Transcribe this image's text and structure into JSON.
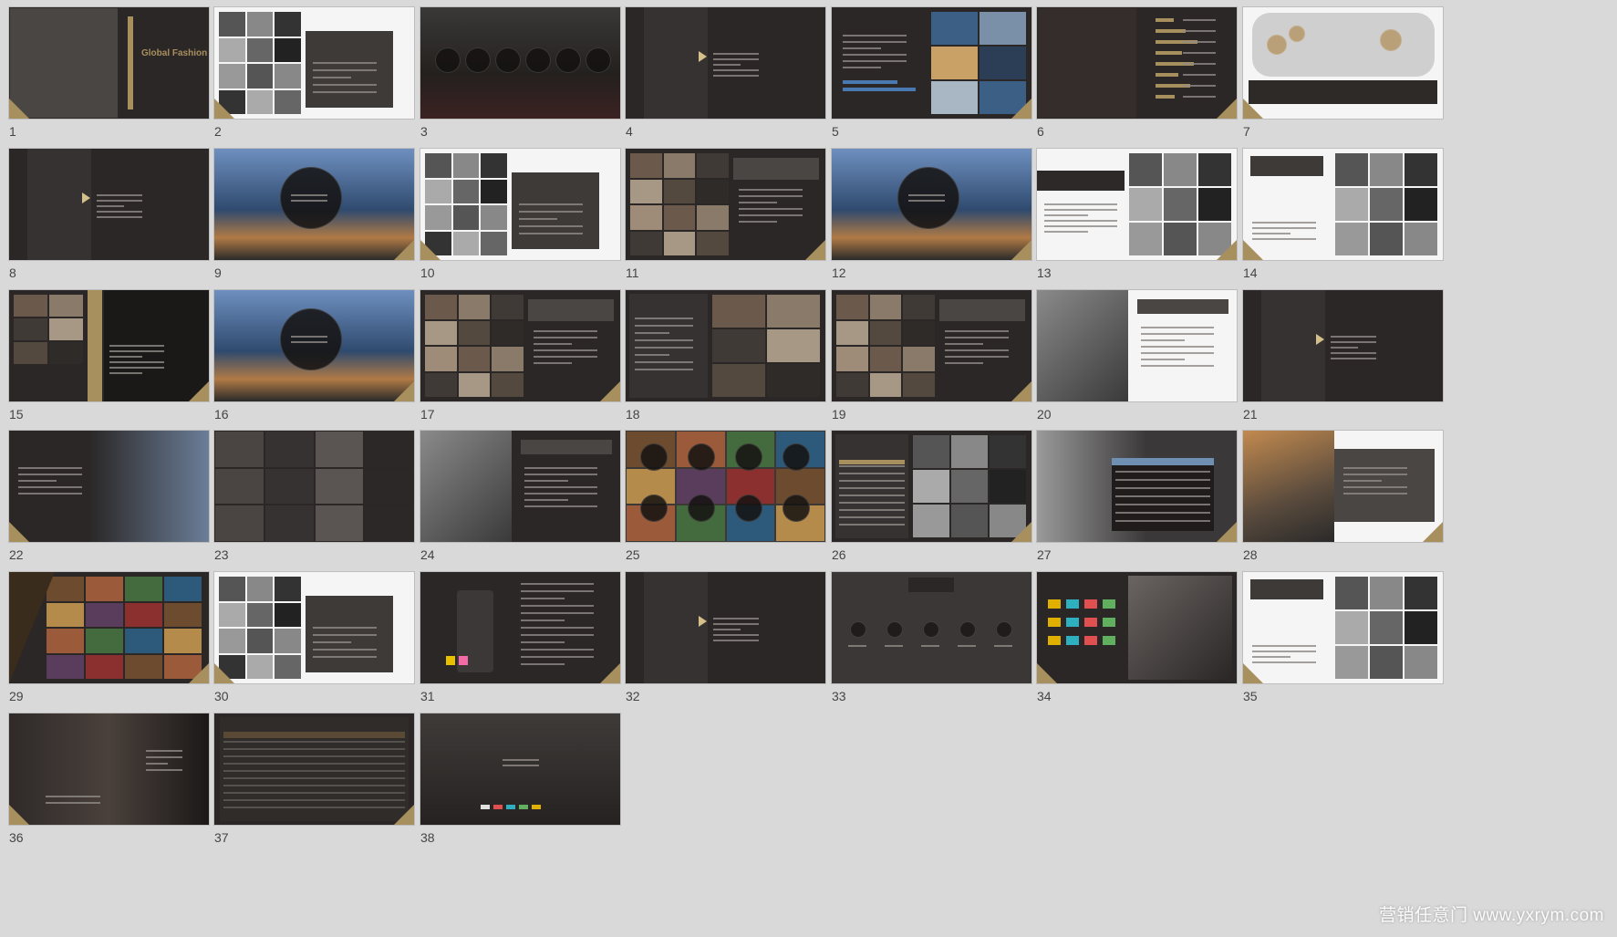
{
  "slides": [
    {
      "n": "1",
      "style": "dark",
      "variant": "cover",
      "caption": "Global Fashion Trip"
    },
    {
      "n": "2",
      "style": "light",
      "variant": "collage-left"
    },
    {
      "n": "3",
      "style": "photo",
      "variant": "circles"
    },
    {
      "n": "4",
      "style": "dark",
      "variant": "video"
    },
    {
      "n": "5",
      "style": "dark",
      "variant": "chart-photos"
    },
    {
      "n": "6",
      "style": "dark",
      "variant": "bars"
    },
    {
      "n": "7",
      "style": "light",
      "variant": "map"
    },
    {
      "n": "8",
      "style": "dark",
      "variant": "video"
    },
    {
      "n": "9",
      "style": "photo",
      "variant": "city-circle"
    },
    {
      "n": "10",
      "style": "light",
      "variant": "collage-left"
    },
    {
      "n": "11",
      "style": "dark",
      "variant": "grid-left"
    },
    {
      "n": "12",
      "style": "photo",
      "variant": "city-circle"
    },
    {
      "n": "13",
      "style": "light",
      "variant": "text-right-grid"
    },
    {
      "n": "14",
      "style": "light",
      "variant": "collage-right"
    },
    {
      "n": "15",
      "style": "dark",
      "variant": "split-gold"
    },
    {
      "n": "16",
      "style": "photo",
      "variant": "city-circle"
    },
    {
      "n": "17",
      "style": "dark",
      "variant": "grid-left"
    },
    {
      "n": "18",
      "style": "dark",
      "variant": "text-left-grid"
    },
    {
      "n": "19",
      "style": "dark",
      "variant": "grid-left"
    },
    {
      "n": "20",
      "style": "light",
      "variant": "photo-left-text"
    },
    {
      "n": "21",
      "style": "dark",
      "variant": "video"
    },
    {
      "n": "22",
      "style": "light",
      "variant": "stage"
    },
    {
      "n": "23",
      "style": "dark",
      "variant": "mosaic"
    },
    {
      "n": "24",
      "style": "dark",
      "variant": "photo-left-text"
    },
    {
      "n": "25",
      "style": "photo",
      "variant": "circles-grid"
    },
    {
      "n": "26",
      "style": "dark",
      "variant": "table-photos"
    },
    {
      "n": "27",
      "style": "dark",
      "variant": "table-right"
    },
    {
      "n": "28",
      "style": "light",
      "variant": "city-left"
    },
    {
      "n": "29",
      "style": "dark",
      "variant": "grid-right"
    },
    {
      "n": "30",
      "style": "light",
      "variant": "collage-left"
    },
    {
      "n": "31",
      "style": "dark",
      "variant": "phone-text"
    },
    {
      "n": "32",
      "style": "dark",
      "variant": "video"
    },
    {
      "n": "33",
      "style": "dark",
      "variant": "social-icons"
    },
    {
      "n": "34",
      "style": "dark",
      "variant": "logos-photo"
    },
    {
      "n": "35",
      "style": "light",
      "variant": "collage-right"
    },
    {
      "n": "36",
      "style": "dark",
      "variant": "dinner"
    },
    {
      "n": "37",
      "style": "dark",
      "variant": "table"
    },
    {
      "n": "38",
      "style": "dark",
      "variant": "thanks"
    }
  ],
  "watermark": "营销任意门 www.yxrym.com",
  "colors": {
    "accent": "#a88f5e",
    "dark": "#2a2726",
    "background": "#d9d9d9"
  }
}
